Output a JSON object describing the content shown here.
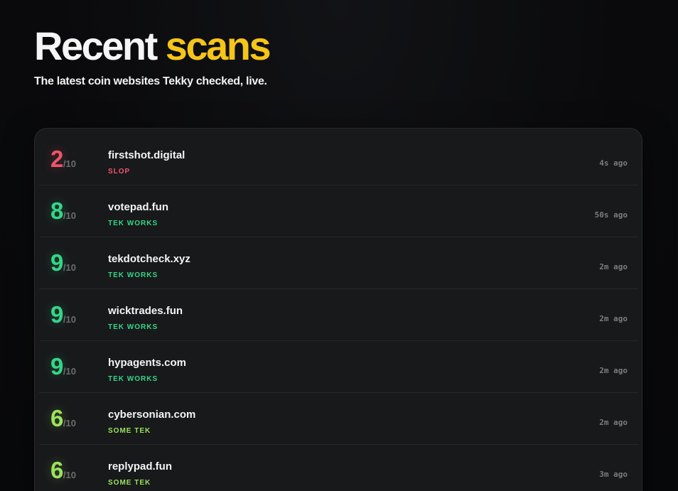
{
  "header": {
    "title_part1": "Recent",
    "title_part2": "scans",
    "subtitle": "The latest coin websites Tekky checked, live."
  },
  "colors": {
    "accent_yellow": "#f5c518",
    "slop_red": "#f0546a",
    "tek_works_green": "#35d687",
    "some_tek_green": "#9be35c",
    "muted_gray": "#6b6d72"
  },
  "scans": [
    {
      "score": "2",
      "out_of": "/10",
      "site": "firstshot.digital",
      "verdict": "SLOP",
      "verdict_color": "#f0546a",
      "time": "4s ago"
    },
    {
      "score": "8",
      "out_of": "/10",
      "site": "votepad.fun",
      "verdict": "TEK WORKS",
      "verdict_color": "#35d687",
      "time": "50s ago"
    },
    {
      "score": "9",
      "out_of": "/10",
      "site": "tekdotcheck.xyz",
      "verdict": "TEK WORKS",
      "verdict_color": "#35d687",
      "time": "2m ago"
    },
    {
      "score": "9",
      "out_of": "/10",
      "site": "wicktrades.fun",
      "verdict": "TEK WORKS",
      "verdict_color": "#35d687",
      "time": "2m ago"
    },
    {
      "score": "9",
      "out_of": "/10",
      "site": "hypagents.com",
      "verdict": "TEK WORKS",
      "verdict_color": "#35d687",
      "time": "2m ago"
    },
    {
      "score": "6",
      "out_of": "/10",
      "site": "cybersonian.com",
      "verdict": "SOME TEK",
      "verdict_color": "#9be35c",
      "time": "2m ago"
    },
    {
      "score": "6",
      "out_of": "/10",
      "site": "replypad.fun",
      "verdict": "SOME TEK",
      "verdict_color": "#9be35c",
      "time": "3m ago"
    }
  ]
}
